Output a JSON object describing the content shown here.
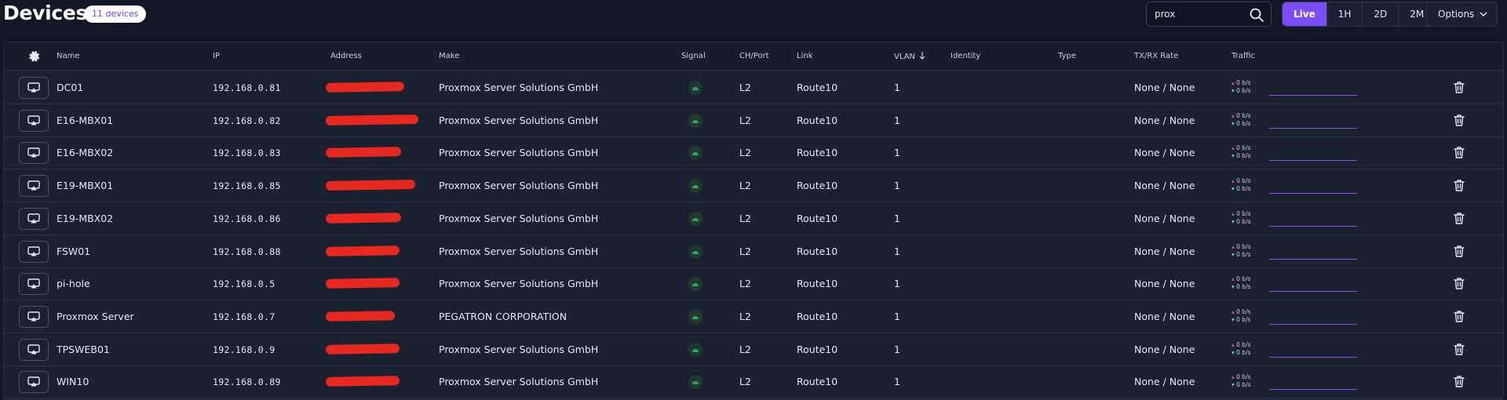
{
  "header": {
    "title": "Devices",
    "count_badge": "11 devices",
    "search_value": "prox",
    "ranges": [
      "Live",
      "1H",
      "2D",
      "2M"
    ],
    "active_range": "Live",
    "options_label": "Options"
  },
  "columns": [
    "Name",
    "IP",
    "Address",
    "Make",
    "Signal",
    "CH/Port",
    "Link",
    "VLAN",
    "Identity",
    "Type",
    "TX/RX Rate",
    "Traffic"
  ],
  "colors": {
    "accent": "#7a4dff",
    "background": "#121826",
    "redaction": "#e8281e",
    "signal": "#2fa36b"
  },
  "rows": [
    {
      "name": "DC01",
      "ip": "192.168.0.81",
      "make": "Proxmox Server Solutions GmbH",
      "ch": "L2",
      "link": "Route10",
      "vlan": "1",
      "identity": "",
      "type": "",
      "rate": "None / None",
      "tx": "0 b/s",
      "rx": "0 b/s"
    },
    {
      "name": "E16-MBX01",
      "ip": "192.168.0.82",
      "make": "Proxmox Server Solutions GmbH",
      "ch": "L2",
      "link": "Route10",
      "vlan": "1",
      "identity": "",
      "type": "",
      "rate": "None / None",
      "tx": "0 b/s",
      "rx": "0 b/s"
    },
    {
      "name": "E16-MBX02",
      "ip": "192.168.0.83",
      "make": "Proxmox Server Solutions GmbH",
      "ch": "L2",
      "link": "Route10",
      "vlan": "1",
      "identity": "",
      "type": "",
      "rate": "None / None",
      "tx": "0 b/s",
      "rx": "0 b/s"
    },
    {
      "name": "E19-MBX01",
      "ip": "192.168.0.85",
      "make": "Proxmox Server Solutions GmbH",
      "ch": "L2",
      "link": "Route10",
      "vlan": "1",
      "identity": "",
      "type": "",
      "rate": "None / None",
      "tx": "0 b/s",
      "rx": "0 b/s"
    },
    {
      "name": "E19-MBX02",
      "ip": "192.168.0.86",
      "make": "Proxmox Server Solutions GmbH",
      "ch": "L2",
      "link": "Route10",
      "vlan": "1",
      "identity": "",
      "type": "",
      "rate": "None / None",
      "tx": "0 b/s",
      "rx": "0 b/s"
    },
    {
      "name": "FSW01",
      "ip": "192.168.0.88",
      "make": "Proxmox Server Solutions GmbH",
      "ch": "L2",
      "link": "Route10",
      "vlan": "1",
      "identity": "",
      "type": "",
      "rate": "None / None",
      "tx": "0 b/s",
      "rx": "0 b/s"
    },
    {
      "name": "pi-hole",
      "ip": "192.168.0.5",
      "make": "Proxmox Server Solutions GmbH",
      "ch": "L2",
      "link": "Route10",
      "vlan": "1",
      "identity": "",
      "type": "",
      "rate": "None / None",
      "tx": "0 b/s",
      "rx": "0 b/s"
    },
    {
      "name": "Proxmox Server",
      "ip": "192.168.0.7",
      "make": "PEGATRON CORPORATION",
      "ch": "L2",
      "link": "Route10",
      "vlan": "1",
      "identity": "",
      "type": "",
      "rate": "None / None",
      "tx": "0 b/s",
      "rx": "0 b/s"
    },
    {
      "name": "TPSWEB01",
      "ip": "192.168.0.9",
      "make": "Proxmox Server Solutions GmbH",
      "ch": "L2",
      "link": "Route10",
      "vlan": "1",
      "identity": "",
      "type": "",
      "rate": "None / None",
      "tx": "0 b/s",
      "rx": "0 b/s"
    },
    {
      "name": "WIN10",
      "ip": "192.168.0.89",
      "make": "Proxmox Server Solutions GmbH",
      "ch": "L2",
      "link": "Route10",
      "vlan": "1",
      "identity": "",
      "type": "",
      "rate": "None / None",
      "tx": "0 b/s",
      "rx": "0 b/s"
    }
  ]
}
